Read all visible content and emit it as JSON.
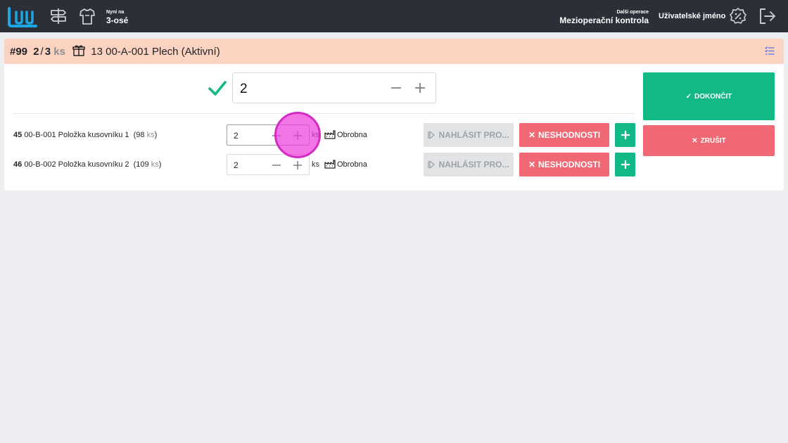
{
  "header": {
    "now_label": "Nyní na",
    "now_value": "3-osé",
    "next_label": "Další operace",
    "next_value": "Mezioperační kontrola",
    "username": "Uživatelské jméno"
  },
  "card": {
    "order": "#99",
    "qty_done": "2",
    "qty_sep": "/",
    "qty_total": "3",
    "qty_unit": "ks",
    "item": "13 00-A-001 Plech (Aktivní)"
  },
  "main_input": {
    "value": "2"
  },
  "rows": [
    {
      "pos": "45",
      "code_name": "00-B-001 Položka kusovníku 1",
      "stock_open": "(98",
      "stock_unit": "ks",
      "stock_close": ")",
      "value": "2",
      "unit": "ks",
      "place": "Obrobna",
      "report_label": "NAHLÁSIT PRO...",
      "nonconf_label": "NESHODNOSTI"
    },
    {
      "pos": "46",
      "code_name": "00-B-002 Položka kusovníku 2",
      "stock_open": "(109",
      "stock_unit": "ks",
      "stock_close": ")",
      "value": "2",
      "unit": "ks",
      "place": "Obrobna",
      "report_label": "NAHLÁSIT PRO...",
      "nonconf_label": "NESHODNOSTI"
    }
  ],
  "actions": {
    "finish_label": "DOKONČIT",
    "cancel_label": "ZRUŠIT"
  },
  "colors": {
    "topbar": "#2b3038",
    "brand": "#1ea5e6",
    "card_head": "#fcd3c1",
    "success": "#12b886",
    "danger": "#ef6873",
    "disabled": "#e2e3e5",
    "tap": "#e040d8"
  },
  "icons": {
    "logo": "brand-logo",
    "routing": "signpost-icon",
    "operator": "shirt-icon",
    "settings": "badge-percent-icon",
    "logout": "logout-icon",
    "box": "package-icon",
    "list": "list-check-icon",
    "check": "check-icon",
    "factory": "factory-icon"
  }
}
